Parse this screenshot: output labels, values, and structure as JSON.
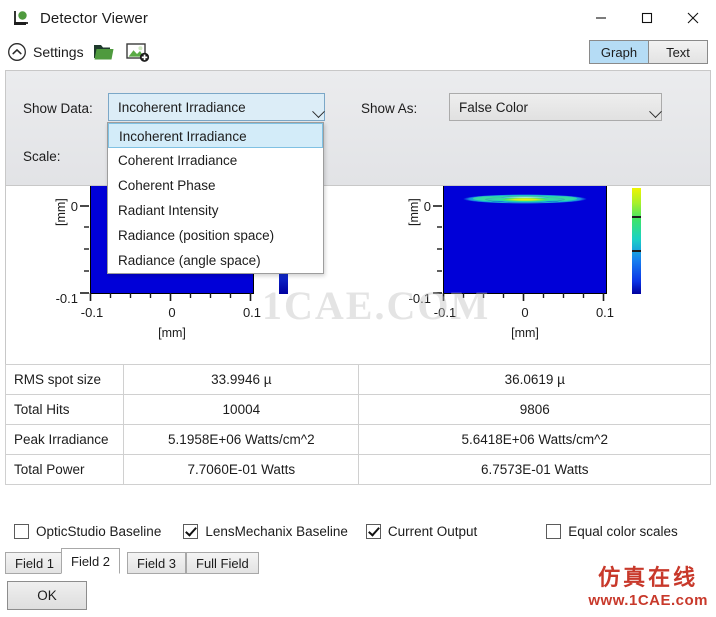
{
  "window": {
    "title": "Detector Viewer",
    "icon": "detector-icon",
    "minimize": "–",
    "maximize": "□",
    "close": "✕"
  },
  "toolbar": {
    "settings_label": "Settings",
    "collapse_icon": "chevron-up-circle-icon",
    "open_icon": "open-folder-icon",
    "save_image_icon": "save-image-icon",
    "view_modes": [
      {
        "label": "Graph",
        "selected": true
      },
      {
        "label": "Text",
        "selected": false
      }
    ]
  },
  "settings": {
    "show_data_label": "Show Data:",
    "show_data_value": "Incoherent Irradiance",
    "scale_label": "Scale:",
    "show_as_label": "Show As:",
    "show_as_value": "False Color",
    "dropdown_open": true,
    "dropdown_options": [
      "Incoherent Irradiance",
      "Coherent Irradiance",
      "Coherent Phase",
      "Radiant Intensity",
      "Radiance (position space)",
      "Radiance (angle space)"
    ],
    "dropdown_selected_index": 0
  },
  "chart_data": [
    {
      "type": "heatmap",
      "name": "left-detector-plot",
      "title": "",
      "xlabel": "[mm]",
      "ylabel": "[mm]",
      "xticks": [
        "-0.1",
        "0",
        "0.1"
      ],
      "yticks": [
        "0",
        "-0.1"
      ],
      "xlim": [
        -0.1,
        0.1
      ],
      "ylim": [
        -0.1,
        0.1
      ],
      "colormap": [
        "#0000d8",
        "#0048ff",
        "#00c8d8",
        "#30e070",
        "#c8f000",
        "#f0f000"
      ],
      "background_value": "#0000d8",
      "colorbar": true,
      "grid": false,
      "note": "plot partially occluded by open dropdown list"
    },
    {
      "type": "heatmap",
      "name": "right-detector-plot",
      "title": "",
      "xlabel": "[mm]",
      "ylabel": "[mm]",
      "xticks": [
        "-0.1",
        "0",
        "0.1"
      ],
      "yticks": [
        "0",
        "-0.1"
      ],
      "xlim": [
        -0.1,
        0.1
      ],
      "ylim": [
        -0.1,
        0.1
      ],
      "colormap": [
        "#0000d8",
        "#0048ff",
        "#00c8d8",
        "#30e070",
        "#c8f000",
        "#f0f000"
      ],
      "background_value": "#0000d8",
      "colorbar": true,
      "grid": false,
      "spot": {
        "shape": "horizontal-lens",
        "center_x": 0.0,
        "center_y": 0.005,
        "width_mm": 0.135,
        "height_mm": 0.012,
        "peak_color": "#e8ee10"
      }
    }
  ],
  "table": {
    "rows": [
      {
        "label": "RMS spot size",
        "col_a": "33.9946 µ",
        "col_b": "36.0619 µ"
      },
      {
        "label": "Total Hits",
        "col_a": "10004",
        "col_b": "9806"
      },
      {
        "label": "Peak Irradiance",
        "col_a": "5.1958E+06 Watts/cm^2",
        "col_b": "5.6418E+06 Watts/cm^2"
      },
      {
        "label": "Total Power",
        "col_a": "7.7060E-01 Watts",
        "col_b": "6.7573E-01 Watts"
      }
    ]
  },
  "checkboxes": [
    {
      "label": "OpticStudio Baseline",
      "checked": false
    },
    {
      "label": "LensMechanix Baseline",
      "checked": true
    },
    {
      "label": "Current Output",
      "checked": true
    },
    {
      "label": "Equal color scales",
      "checked": false
    }
  ],
  "tabs": [
    {
      "label": "Field 1",
      "selected": false
    },
    {
      "label": "Field 2",
      "selected": true
    },
    {
      "label": "Field 3",
      "selected": false
    },
    {
      "label": "Full Field",
      "selected": false
    }
  ],
  "footer": {
    "ok_label": "OK"
  },
  "watermarks": {
    "center": "1CAE.COM",
    "bottom_line1": "仿真在线",
    "bottom_line2": "www.1CAE.com"
  },
  "colors": {
    "accent": "#b5dcf5",
    "panel": "#e8e9eb",
    "combo_open": "#dcedf7",
    "dropdown_sel": "#d3ecf9",
    "folder_green": "#4a9b3c",
    "watermark_red": "#c8392b"
  }
}
